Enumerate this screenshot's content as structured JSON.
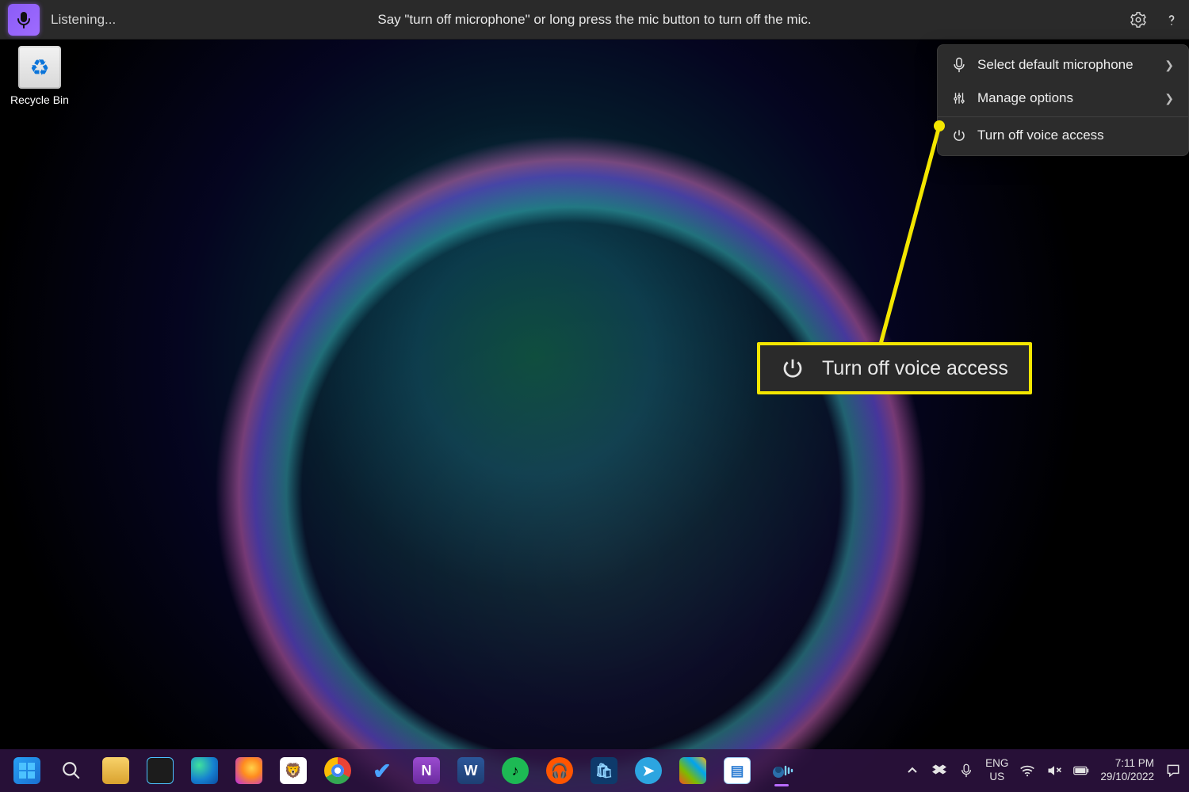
{
  "voiceAccess": {
    "status": "Listening...",
    "hint": "Say \"turn off microphone\" or long press the mic button to turn off the mic.",
    "menu": {
      "selectMic": "Select default microphone",
      "manage": "Manage options",
      "turnOff": "Turn off voice access"
    }
  },
  "callout": {
    "label": "Turn off voice access"
  },
  "desktop": {
    "recycleBin": "Recycle Bin"
  },
  "taskbar": {
    "lang1": "ENG",
    "lang2": "US",
    "time": "7:11 PM",
    "date": "29/10/2022"
  }
}
